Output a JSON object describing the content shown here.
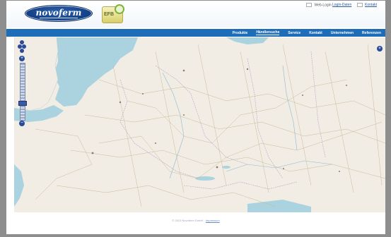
{
  "header": {
    "logo_text": "novoferm",
    "badge_text": "EFB",
    "login": {
      "prefix": "Web-Login",
      "link1": "Login-Daten",
      "link2": "Kontakt"
    }
  },
  "nav": {
    "items": [
      {
        "label": "Produkte",
        "active": false
      },
      {
        "label": "Händlersuche",
        "active": true
      },
      {
        "label": "Service",
        "active": false
      },
      {
        "label": "Kontakt",
        "active": false
      },
      {
        "label": "Unternehmen",
        "active": false
      },
      {
        "label": "Referenzen",
        "active": false
      }
    ]
  },
  "map": {
    "zoom_in_label": "+",
    "zoom_out_label": "−",
    "layer_switch_label": "+",
    "water_color": "#aad3df",
    "land_color": "#f1ede4"
  },
  "footer": {
    "text": "© 2012 Novoferm GmbH ·",
    "link": "Impressum"
  }
}
